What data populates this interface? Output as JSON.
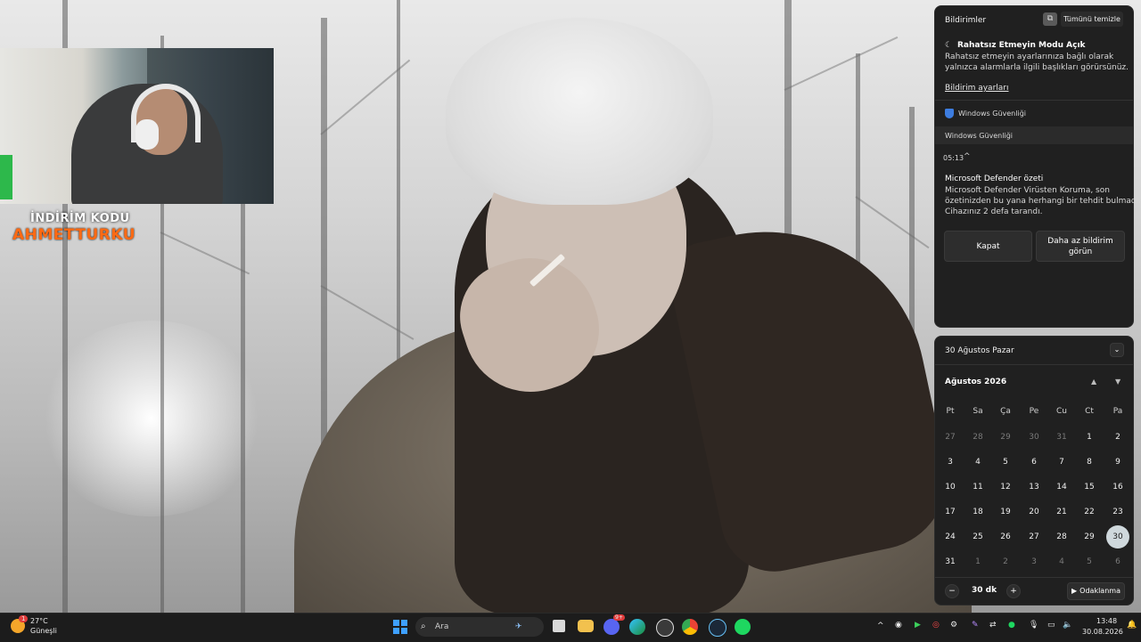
{
  "overlay": {
    "promo_line1": "İNDİRİM KODU",
    "promo_line2": "AHMETTURKU"
  },
  "notifications": {
    "title": "Bildirimler",
    "clear_all": "Tümünü temizle",
    "dnd_title": "Rahatsız Etmeyin Modu Açık",
    "dnd_body_1": "Rahatsız etmeyin ayarlarınıza bağlı olarak",
    "dnd_body_2": "yalnızca alarmlarla ilgili başlıkları görürsünüz.",
    "settings_link": "Bildirim ayarları",
    "app_name": "Windows Güvenliği",
    "group_name": "Windows Güvenliği",
    "time": "05:13",
    "card_title": "Microsoft Defender özeti",
    "card_body_1": "Microsoft Defender Virüsten Koruma, son",
    "card_body_2": "özetinizden bu yana herhangi bir tehdit bulmadı.",
    "card_body_3": "Cihazınız 2 defa tarandı.",
    "btn_close": "Kapat",
    "btn_less_1": "Daha az bildirim",
    "btn_less_2": "görün"
  },
  "calendar": {
    "date_header": "30 Ağustos Pazar",
    "month_title": "Ağustos 2026",
    "weekdays": [
      "Pt",
      "Sa",
      "Ça",
      "Pe",
      "Cu",
      "Ct",
      "Pa"
    ],
    "weeks": [
      [
        "27",
        "28",
        "29",
        "30",
        "31",
        "1",
        "2"
      ],
      [
        "3",
        "4",
        "5",
        "6",
        "7",
        "8",
        "9"
      ],
      [
        "10",
        "11",
        "12",
        "13",
        "14",
        "15",
        "16"
      ],
      [
        "17",
        "18",
        "19",
        "20",
        "21",
        "22",
        "23"
      ],
      [
        "24",
        "25",
        "26",
        "27",
        "28",
        "29",
        "30"
      ],
      [
        "31",
        "1",
        "2",
        "3",
        "4",
        "5",
        "6"
      ]
    ],
    "focus_minutes": "30 dk",
    "focus_minus": "−",
    "focus_plus": "+",
    "focus_button": "Odaklanma"
  },
  "taskbar": {
    "weather_temp": "27°C",
    "weather_desc": "Güneşli",
    "weather_badge": "1",
    "search_placeholder": "Ara",
    "clock_time": "13:48",
    "clock_date": "30.08.2026",
    "discord_badge": "9+"
  }
}
